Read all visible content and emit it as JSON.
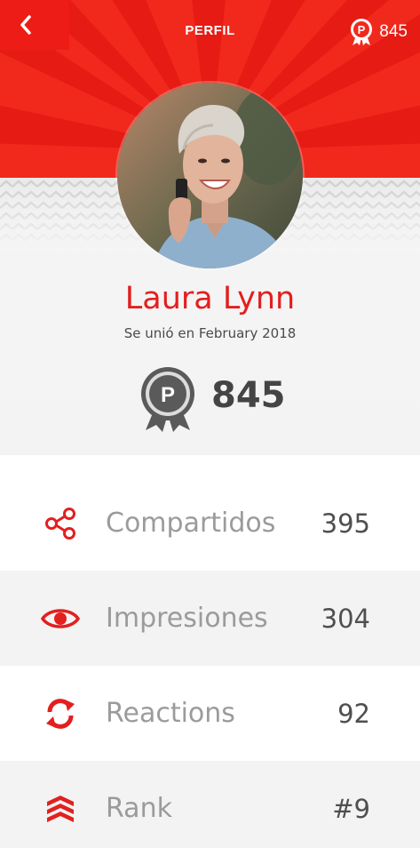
{
  "header": {
    "title": "PERFIL",
    "points": "845",
    "back_icon": "chevron-left-icon",
    "points_icon": "badge-p-icon",
    "accent_color": "#f1291d"
  },
  "profile": {
    "name": "Laura Lynn",
    "joined": "Se unió en February 2018",
    "points": "845",
    "name_color": "#e31f1f"
  },
  "stats": [
    {
      "label": "Compartidos",
      "value": "395",
      "icon": "share-icon"
    },
    {
      "label": "Impresiones",
      "value": "304",
      "icon": "eye-icon"
    },
    {
      "label": "Reactions",
      "value": "92",
      "icon": "refresh-icon"
    },
    {
      "label": "Rank",
      "value": "#9",
      "icon": "rank-chevrons-icon"
    }
  ]
}
